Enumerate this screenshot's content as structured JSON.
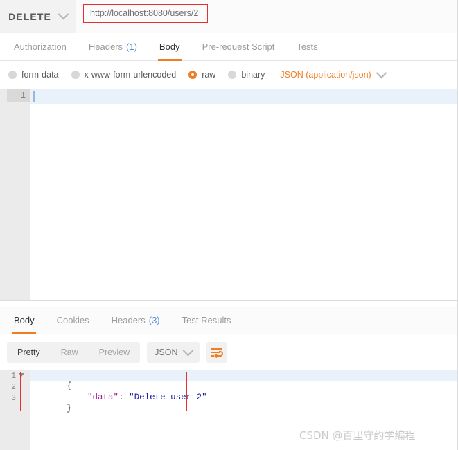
{
  "request_bar": {
    "method": "DELETE",
    "method_caret_icon": "chevron-down-icon",
    "url": "http://localhost:8080/users/2",
    "url_placeholder": "Enter request URL",
    "highlight_color": "#ea2d2d"
  },
  "request_tabs": [
    {
      "label": "Authorization",
      "count": "",
      "active": false
    },
    {
      "label": "Headers",
      "count": "(1)",
      "active": false
    },
    {
      "label": "Body",
      "count": "",
      "active": true
    },
    {
      "label": "Pre-request Script",
      "count": "",
      "active": false
    },
    {
      "label": "Tests",
      "count": "",
      "active": false
    }
  ],
  "body_type": {
    "options": [
      {
        "label": "form-data",
        "selected": false
      },
      {
        "label": "x-www-form-urlencoded",
        "selected": false
      },
      {
        "label": "raw",
        "selected": true
      },
      {
        "label": "binary",
        "selected": false
      }
    ],
    "content_type": "JSON (application/json)",
    "content_type_caret_icon": "chevron-down-icon",
    "accent_color": "#ef7d24"
  },
  "request_editor": {
    "line_numbers": [
      "1"
    ],
    "content": "",
    "active_line": 1
  },
  "response_tabs": [
    {
      "label": "Body",
      "count": "",
      "active": true
    },
    {
      "label": "Cookies",
      "count": "",
      "active": false
    },
    {
      "label": "Headers",
      "count": "(3)",
      "active": false
    },
    {
      "label": "Test Results",
      "count": "",
      "active": false
    }
  ],
  "response_toolbar": {
    "views": [
      {
        "label": "Pretty",
        "active": true
      },
      {
        "label": "Raw",
        "active": false
      },
      {
        "label": "Preview",
        "active": false
      }
    ],
    "format": "JSON",
    "format_caret_icon": "chevron-down-icon",
    "wrap_icon": "word-wrap-icon"
  },
  "response_body": {
    "line_numbers": [
      "1",
      "2",
      "3"
    ],
    "fold_icon": "fold-triangle-icon",
    "lines": [
      {
        "n": "1",
        "open_brace": "{"
      },
      {
        "n": "2",
        "key": "\"data\"",
        "colon": ": ",
        "value": "\"Delete user 2\""
      },
      {
        "n": "3",
        "close_brace": "}"
      }
    ],
    "raw_text": "{\n    \"data\": \"Delete user 2\"\n}",
    "key_color": "#a11f8f",
    "string_color": "#1a1aa6"
  },
  "watermark": {
    "text": "CSDN @百里守约学编程"
  }
}
